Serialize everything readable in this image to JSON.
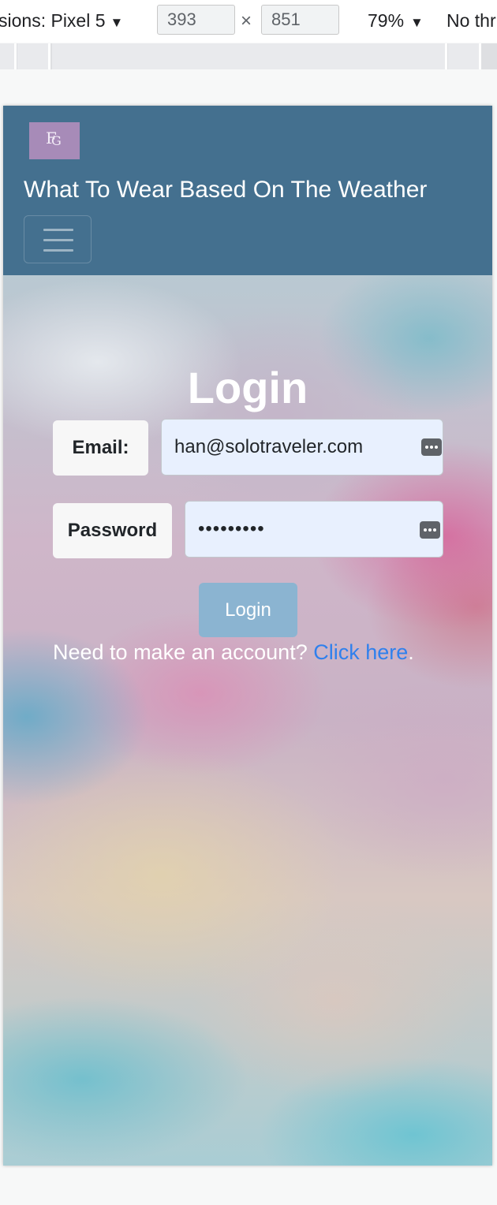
{
  "devtools": {
    "device_label": "sions: Pixel 5",
    "width": "393",
    "height": "851",
    "times": "×",
    "zoom": "79%",
    "throttle": "No thr",
    "caret": "▼"
  },
  "navbar": {
    "logo_text_1": "F",
    "logo_text_2": "G",
    "title": "What To Wear Based On The Weather"
  },
  "login": {
    "heading": "Login",
    "email_label": "Email:",
    "email_value": "han@solotraveler.com",
    "password_label": "Password",
    "password_value": "•••••••••",
    "button_label": "Login",
    "signup_prompt": "Need to make an account? ",
    "signup_link": "Click here",
    "signup_end": "."
  },
  "colors": {
    "navbar": "#44708f",
    "logo": "#a78bb8",
    "button": "#8bb4d1",
    "link": "#2f80ed",
    "autofill": "#e8f0fe"
  },
  "icons": {
    "dropdown": "caret-down-icon",
    "menu": "hamburger-icon",
    "autofill_key": "password-manager-key-icon"
  }
}
